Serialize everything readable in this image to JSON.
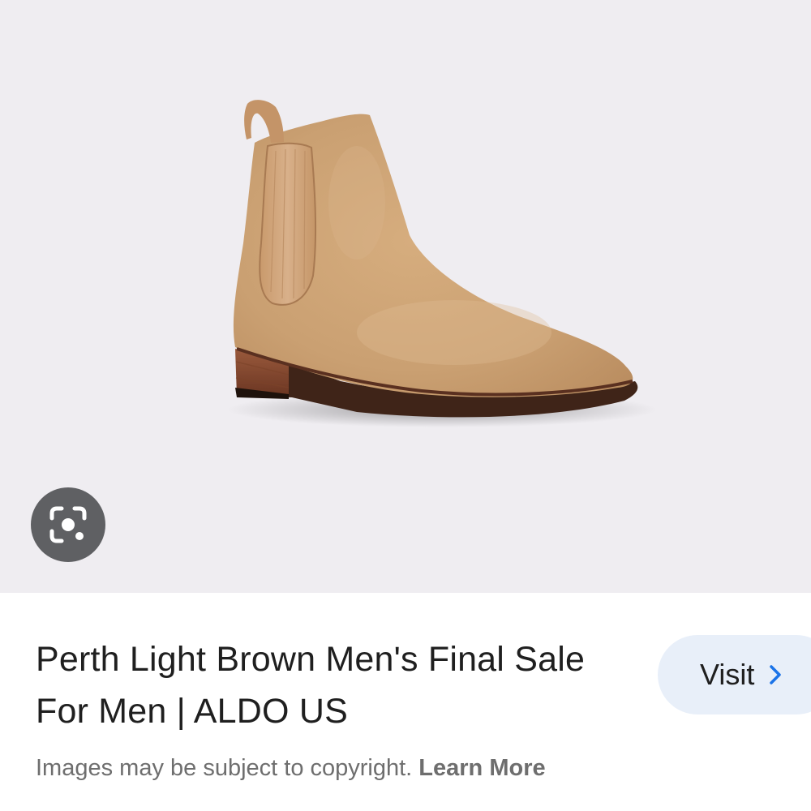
{
  "image_viewer": {
    "image_subject": "light brown suede chelsea boot",
    "background_color": "#efedf1",
    "lens_button": {
      "icon": "google-lens-icon",
      "color": "#5f6063"
    }
  },
  "result": {
    "title": "Perth Light Brown Men's Final Sale For Men | ALDO US",
    "visit_button": {
      "label": "Visit",
      "icon": "chevron-right-icon",
      "accent_color": "#1a73e8",
      "background": "#e8eff9"
    }
  },
  "footer": {
    "copyright_text": "Images may be subject to copyright.",
    "learn_more_label": "Learn More"
  }
}
